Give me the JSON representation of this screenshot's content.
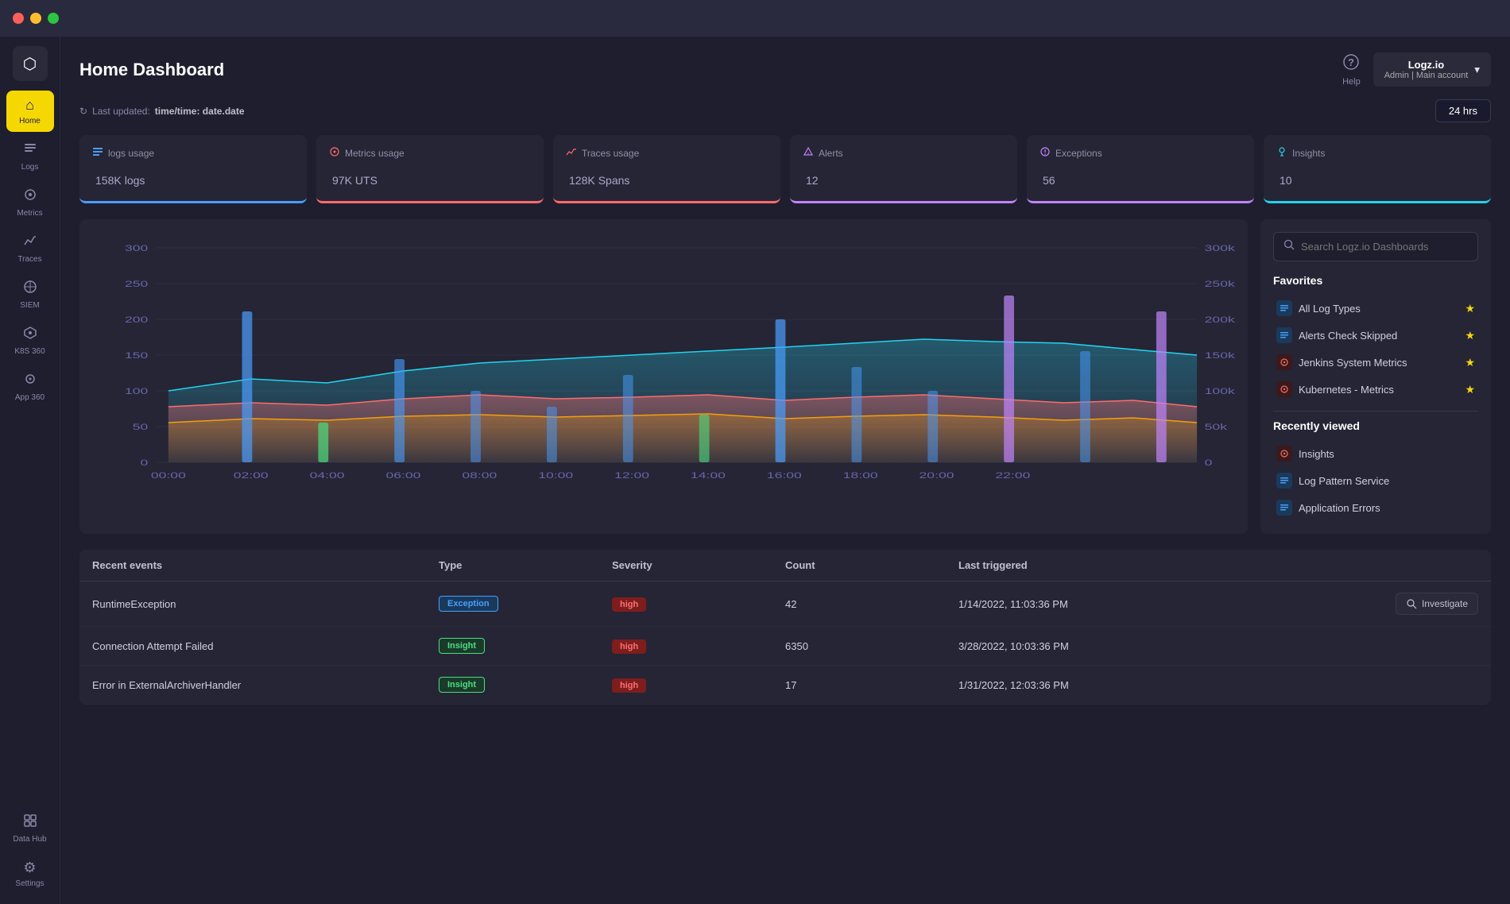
{
  "titlebar": {
    "dots": [
      "red",
      "yellow",
      "green"
    ]
  },
  "sidebar": {
    "logo_icon": "⬡",
    "items": [
      {
        "id": "home",
        "label": "Home",
        "icon": "⌂",
        "active": true
      },
      {
        "id": "logs",
        "label": "Logs",
        "icon": "≡",
        "active": false
      },
      {
        "id": "metrics",
        "label": "Metrics",
        "icon": "◎",
        "active": false
      },
      {
        "id": "traces",
        "label": "Traces",
        "icon": "⋗",
        "active": false
      },
      {
        "id": "siem",
        "label": "SIEM",
        "icon": "◈",
        "active": false
      },
      {
        "id": "k8s360",
        "label": "K8S 360",
        "icon": "✦",
        "active": false
      },
      {
        "id": "app360",
        "label": "App 360",
        "icon": "◉",
        "active": false
      }
    ],
    "bottom_items": [
      {
        "id": "datahub",
        "label": "Data Hub",
        "icon": "⊞"
      },
      {
        "id": "settings",
        "label": "Settings",
        "icon": "⚙"
      }
    ]
  },
  "header": {
    "title": "Home Dashboard",
    "help_label": "Help",
    "account": {
      "name": "Logz.io",
      "role": "Admin",
      "account_type": "Main account"
    }
  },
  "status_bar": {
    "last_updated_label": "Last updated:",
    "time_value": "time/time: date.date",
    "time_range": "24 hrs"
  },
  "stats": [
    {
      "id": "logs",
      "icon": "≡",
      "label": "logs usage",
      "value": "158K",
      "unit": "logs",
      "type": "logs"
    },
    {
      "id": "metrics",
      "icon": "◎",
      "label": "Metrics usage",
      "value": "97K",
      "unit": "UTS",
      "type": "metrics"
    },
    {
      "id": "traces",
      "icon": "⋗",
      "label": "Traces usage",
      "value": "128K",
      "unit": "Spans",
      "type": "traces"
    },
    {
      "id": "alerts",
      "icon": "🔔",
      "label": "Alerts",
      "value": "12",
      "unit": "",
      "type": "alerts"
    },
    {
      "id": "exceptions",
      "icon": "◈",
      "label": "Exceptions",
      "value": "56",
      "unit": "",
      "type": "exceptions"
    },
    {
      "id": "insights",
      "icon": "💡",
      "label": "Insights",
      "value": "10",
      "unit": "",
      "type": "insights"
    }
  ],
  "right_panel": {
    "search_placeholder": "Search Logz.io Dashboards",
    "favorites_title": "Favorites",
    "favorites": [
      {
        "id": "all-log-types",
        "label": "All Log Types",
        "icon_type": "logs",
        "starred": true
      },
      {
        "id": "alerts-check-skipped",
        "label": "Alerts Check Skipped",
        "icon_type": "logs",
        "starred": true
      },
      {
        "id": "jenkins-metrics",
        "label": "Jenkins System Metrics",
        "icon_type": "metrics",
        "starred": true
      },
      {
        "id": "kubernetes-metrics",
        "label": "Kubernetes - Metrics",
        "icon_type": "metrics",
        "starred": true
      }
    ],
    "recently_viewed_title": "Recently viewed",
    "recently_viewed": [
      {
        "id": "insights",
        "label": "Insights",
        "icon_type": "metrics"
      },
      {
        "id": "log-pattern-service",
        "label": "Log Pattern Service",
        "icon_type": "logs"
      },
      {
        "id": "application-errors",
        "label": "Application Errors",
        "icon_type": "logs"
      }
    ]
  },
  "events_table": {
    "title": "Recent events",
    "columns": [
      "Recent events",
      "Type",
      "Severity",
      "Count",
      "Last triggered"
    ],
    "rows": [
      {
        "event": "RuntimeException",
        "type": "Exception",
        "type_class": "exception",
        "severity": "high",
        "count": "42",
        "triggered": "1/14/2022, 11:03:36 PM",
        "show_investigate": true
      },
      {
        "event": "Connection Attempt Failed",
        "type": "Insight",
        "type_class": "insight",
        "severity": "high",
        "count": "6350",
        "triggered": "3/28/2022, 10:03:36 PM",
        "show_investigate": false
      },
      {
        "event": "Error in ExternalArchiverHandler",
        "type": "Insight",
        "type_class": "insight",
        "severity": "high",
        "count": "17",
        "triggered": "1/31/2022, 12:03:36 PM",
        "show_investigate": false
      }
    ],
    "investigate_label": "Investigate"
  },
  "chart": {
    "y_labels_left": [
      "300",
      "250",
      "200",
      "150",
      "100",
      "50",
      "0"
    ],
    "y_labels_right": [
      "300k",
      "250k",
      "200k",
      "150k",
      "100k",
      "50k",
      "0"
    ],
    "x_labels": [
      "00:00",
      "02:00",
      "04:00",
      "06:00",
      "08:00",
      "10:00",
      "12:00",
      "14:00",
      "16:00",
      "18:00",
      "20:00",
      "22:00"
    ]
  },
  "colors": {
    "accent_yellow": "#f5d800",
    "bg_dark": "#1e1e2e",
    "bg_card": "#252535",
    "border": "#3a3a4a",
    "text_primary": "#ffffff",
    "text_secondary": "#8888aa",
    "teal": "#22d3ee",
    "orange": "#ff6b6b",
    "blue": "#4a9eff",
    "purple": "#c084fc",
    "green": "#4ade80"
  }
}
